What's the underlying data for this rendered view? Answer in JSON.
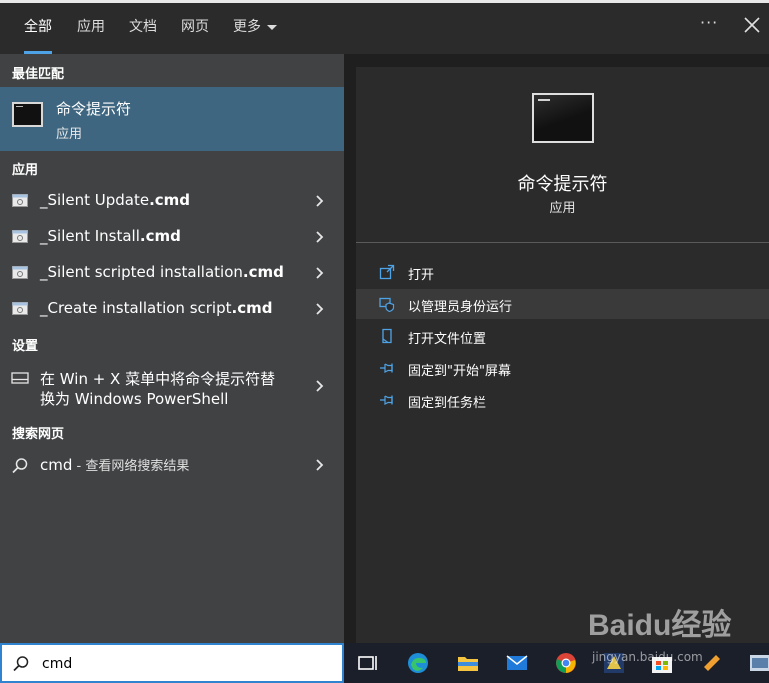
{
  "tabs": [
    {
      "label": "全部",
      "active": true
    },
    {
      "label": "应用"
    },
    {
      "label": "文档"
    },
    {
      "label": "网页"
    },
    {
      "label": "更多"
    }
  ],
  "window": {
    "more_dots": "···"
  },
  "left": {
    "best_match": {
      "section": "最佳匹配",
      "title": "命令提示符",
      "subtitle": "应用",
      "icon": "cmd-icon"
    },
    "apps": {
      "section": "应用",
      "items": [
        {
          "name": "_Silent Update",
          "ext": ".cmd"
        },
        {
          "name": "_Silent Install",
          "ext": ".cmd"
        },
        {
          "name": "_Silent scripted installation",
          "ext": ".cmd"
        },
        {
          "name": "_Create installation script",
          "ext": ".cmd"
        }
      ]
    },
    "settings": {
      "section": "设置",
      "label": "在 Win + X 菜单中将命令提示符替换为 Windows PowerShell"
    },
    "web": {
      "section": "搜索网页",
      "query": "cmd",
      "suffix": " - 查看网络搜索结果"
    }
  },
  "detail": {
    "title": "命令提示符",
    "subtitle": "应用",
    "actions": [
      {
        "label": "打开",
        "icon": "open-icon"
      },
      {
        "label": "以管理员身份运行",
        "icon": "shield-icon",
        "highlighted": true
      },
      {
        "label": "打开文件位置",
        "icon": "file-location-icon"
      },
      {
        "label": "固定到\"开始\"屏幕",
        "icon": "pin-icon"
      },
      {
        "label": "固定到任务栏",
        "icon": "pin-icon"
      }
    ]
  },
  "search": {
    "value": "cmd"
  },
  "watermark": {
    "logo": "Baidu经验",
    "url": "jingyan.baidu.com"
  },
  "colors": {
    "accent": "#4ea3e6",
    "selected": "#3f6681",
    "left_bg": "#414244",
    "right_bg": "#2b2b2b"
  }
}
